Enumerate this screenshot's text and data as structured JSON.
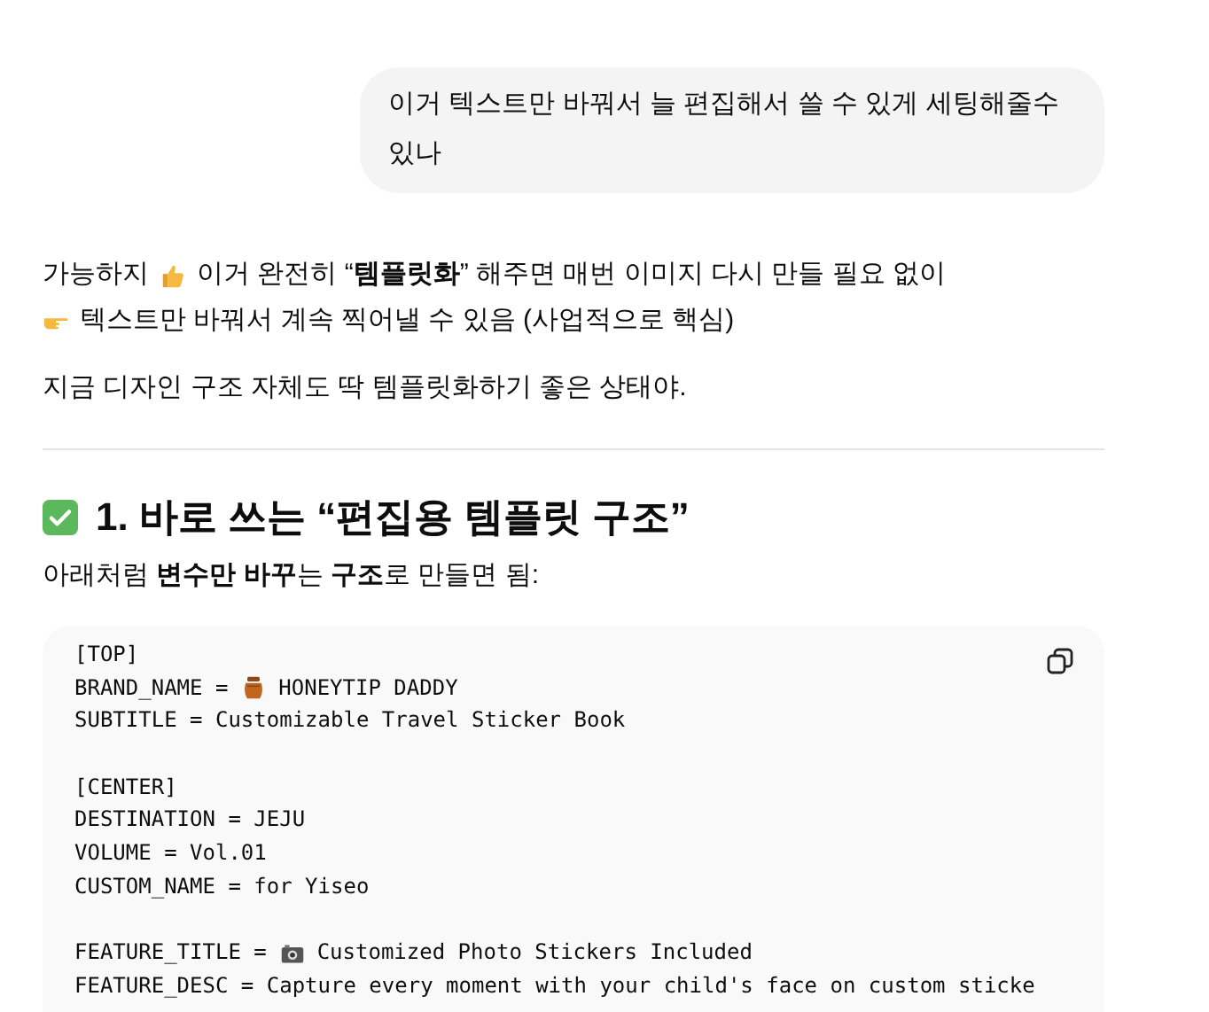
{
  "user_message": {
    "text": "이거 텍스트만 바꿔서 늘 편집해서 쓸 수 있게 세팅해줄수 있나"
  },
  "answer": {
    "intro_lines": [
      [
        {
          "text": "가능하지"
        },
        {
          "kind": "thumbs"
        },
        {
          "text": "이거 완전히 “**템플릿화**” 해주면 매번 이미지 다시 만들 필요 없이"
        }
      ],
      [
        {
          "kind": "pointing"
        },
        {
          "text": "텍스트만 바꿔서 계속 찍어낼 수 있음 (사업적으로 핵심)"
        }
      ]
    ],
    "paragraph": "지금 디자인 구조 자체도 딱 템플릿화하기 좋은 상태야.",
    "heading": [
      {
        "kind": "check"
      },
      {
        "text": "1. 바로 쓰는 “편집용 템플릿 구조”"
      }
    ],
    "heading_note": "아래처럼 **변수만 바꾸**는 **구조**로 만들면 됨:",
    "code_lines": [
      [
        {
          "text": "[TOP]"
        }
      ],
      [
        {
          "text": "BRAND_NAME = "
        },
        {
          "kind": "honey"
        },
        {
          "text": " HONEYTIP DADDY"
        }
      ],
      [
        {
          "text": "SUBTITLE = Customizable Travel Sticker Book"
        }
      ],
      [
        {
          "kind": "blank"
        }
      ],
      [
        {
          "text": "[CENTER]"
        }
      ],
      [
        {
          "text": "DESTINATION = JEJU"
        }
      ],
      [
        {
          "text": "VOLUME = Vol.01"
        }
      ],
      [
        {
          "text": "CUSTOM_NAME = for Yiseo"
        }
      ],
      [
        {
          "kind": "blank"
        }
      ],
      [
        {
          "text": "FEATURE_TITLE = "
        },
        {
          "kind": "camera"
        },
        {
          "text": " Customized Photo Stickers Included"
        }
      ],
      [
        {
          "text": "FEATURE_DESC = Capture every moment with your child's face on custom sticke"
        }
      ]
    ]
  }
}
